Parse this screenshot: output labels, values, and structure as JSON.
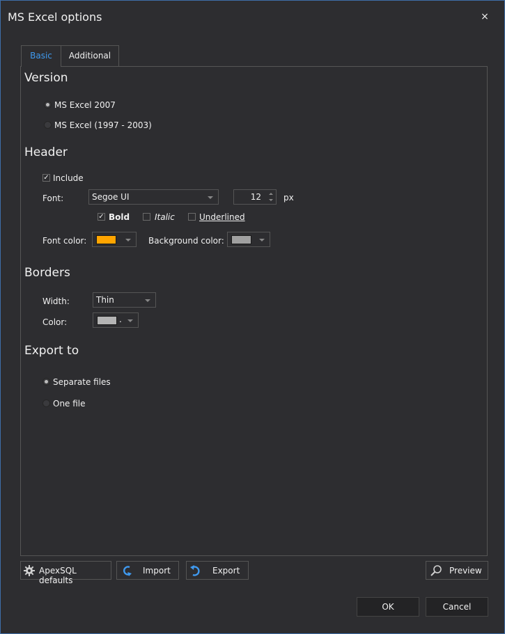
{
  "window": {
    "title": "MS Excel options",
    "close_glyph": "×"
  },
  "tabs": [
    {
      "label": "Basic",
      "active": true
    },
    {
      "label": "Additional",
      "active": false
    }
  ],
  "version": {
    "heading": "Version",
    "options": [
      {
        "label": "MS Excel 2007",
        "selected": true
      },
      {
        "label": "MS Excel (1997 - 2003)",
        "selected": false
      }
    ]
  },
  "header": {
    "heading": "Header",
    "include_label": "Include",
    "include_checked": true,
    "font_label": "Font:",
    "font_value": "Segoe UI",
    "size_value": "12",
    "size_unit": "px",
    "bold_label": "Bold",
    "bold_checked": true,
    "italic_label": "Italic",
    "underlined_label": "Underlined",
    "font_color_label": "Font color:",
    "font_color": "#ffa500",
    "bg_color_label": "Background color:",
    "bg_color": "#a0a0a0"
  },
  "borders": {
    "heading": "Borders",
    "width_label": "Width:",
    "width_value": "Thin",
    "color_label": "Color:",
    "color_value": "#b4b4b4",
    "color_suffix": "."
  },
  "export_to": {
    "heading": "Export to",
    "options": [
      {
        "label": "Separate files",
        "selected": true
      },
      {
        "label": "One file",
        "selected": false
      }
    ]
  },
  "buttons": {
    "defaults": "ApexSQL defaults",
    "import": "Import",
    "export": "Export",
    "preview": "Preview",
    "ok": "OK",
    "cancel": "Cancel"
  },
  "icons": {
    "defaults": "gear-icon",
    "import": "import-arrow-icon",
    "export": "export-arrow-icon",
    "preview": "magnifier-icon"
  },
  "colors": {
    "accent": "#3f9af0",
    "background": "#2d2d30",
    "border": "#555555"
  }
}
